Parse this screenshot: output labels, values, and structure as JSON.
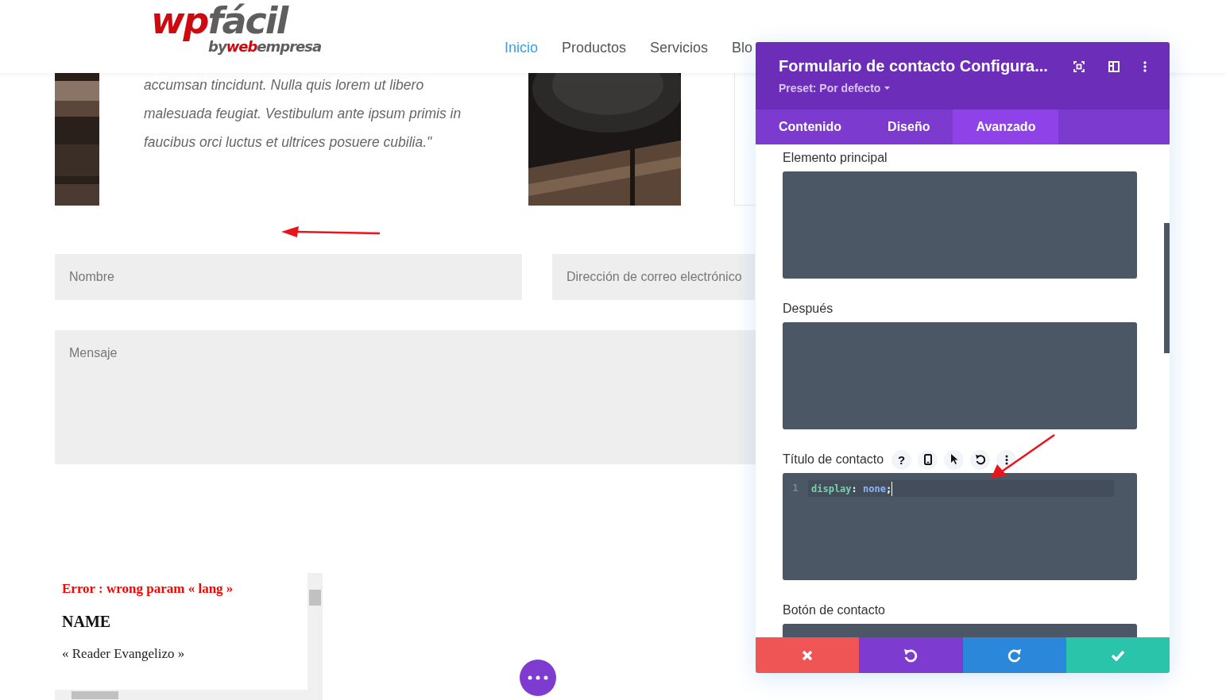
{
  "header": {
    "logo": {
      "wp": "wp",
      "facil": "fácil",
      "by": "by",
      "web": "web",
      "empresa": "empresa"
    },
    "nav": [
      {
        "label": "Inicio",
        "selected": true
      },
      {
        "label": "Productos",
        "selected": false
      },
      {
        "label": "Servicios",
        "selected": false
      },
      {
        "label": "Blo",
        "selected": false
      }
    ]
  },
  "testimonial": {
    "lines": [
      "accumsan tincidunt. Nulla quis lorem ut libero",
      "malesuada feugiat. Vestibulum ante ipsum primis in",
      "faucibus orci luctus et ultrices posuere cubilia.\""
    ]
  },
  "form": {
    "fields": [
      {
        "placeholder": "Nombre"
      },
      {
        "placeholder": "Dirección de correo electrónico"
      }
    ],
    "message": {
      "placeholder": "Mensaje"
    }
  },
  "embed": {
    "error": "Error : wrong param « lang »",
    "heading": "NAME",
    "text": "« Reader Evangelizo »"
  },
  "panel": {
    "title": "Formulario de contacto Configura...",
    "preset": "Preset: Por defecto",
    "tabs": [
      {
        "label": "Contenido",
        "selected": false
      },
      {
        "label": "Diseño",
        "selected": false
      },
      {
        "label": "Avanzado",
        "selected": true
      }
    ],
    "sections": [
      {
        "label": "Elemento principal",
        "kind": "box"
      },
      {
        "label": "Después",
        "kind": "box"
      },
      {
        "label": "Título de contacto",
        "kind": "code",
        "help": "?",
        "line_number": "1",
        "tokens": [
          {
            "text": "display",
            "kind": "property"
          },
          {
            "text": ": ",
            "kind": "punct"
          },
          {
            "text": "none",
            "kind": "value"
          },
          {
            "text": ";",
            "kind": "punct"
          }
        ]
      },
      {
        "label": "Botón de contacto",
        "kind": "box"
      }
    ],
    "actions": [
      {
        "kind": "cancel",
        "color": "#ef5555"
      },
      {
        "kind": "undo",
        "color": "#7e3bd0"
      },
      {
        "kind": "redo",
        "color": "#2b87da"
      },
      {
        "kind": "save",
        "color": "#29c4a9"
      }
    ]
  }
}
